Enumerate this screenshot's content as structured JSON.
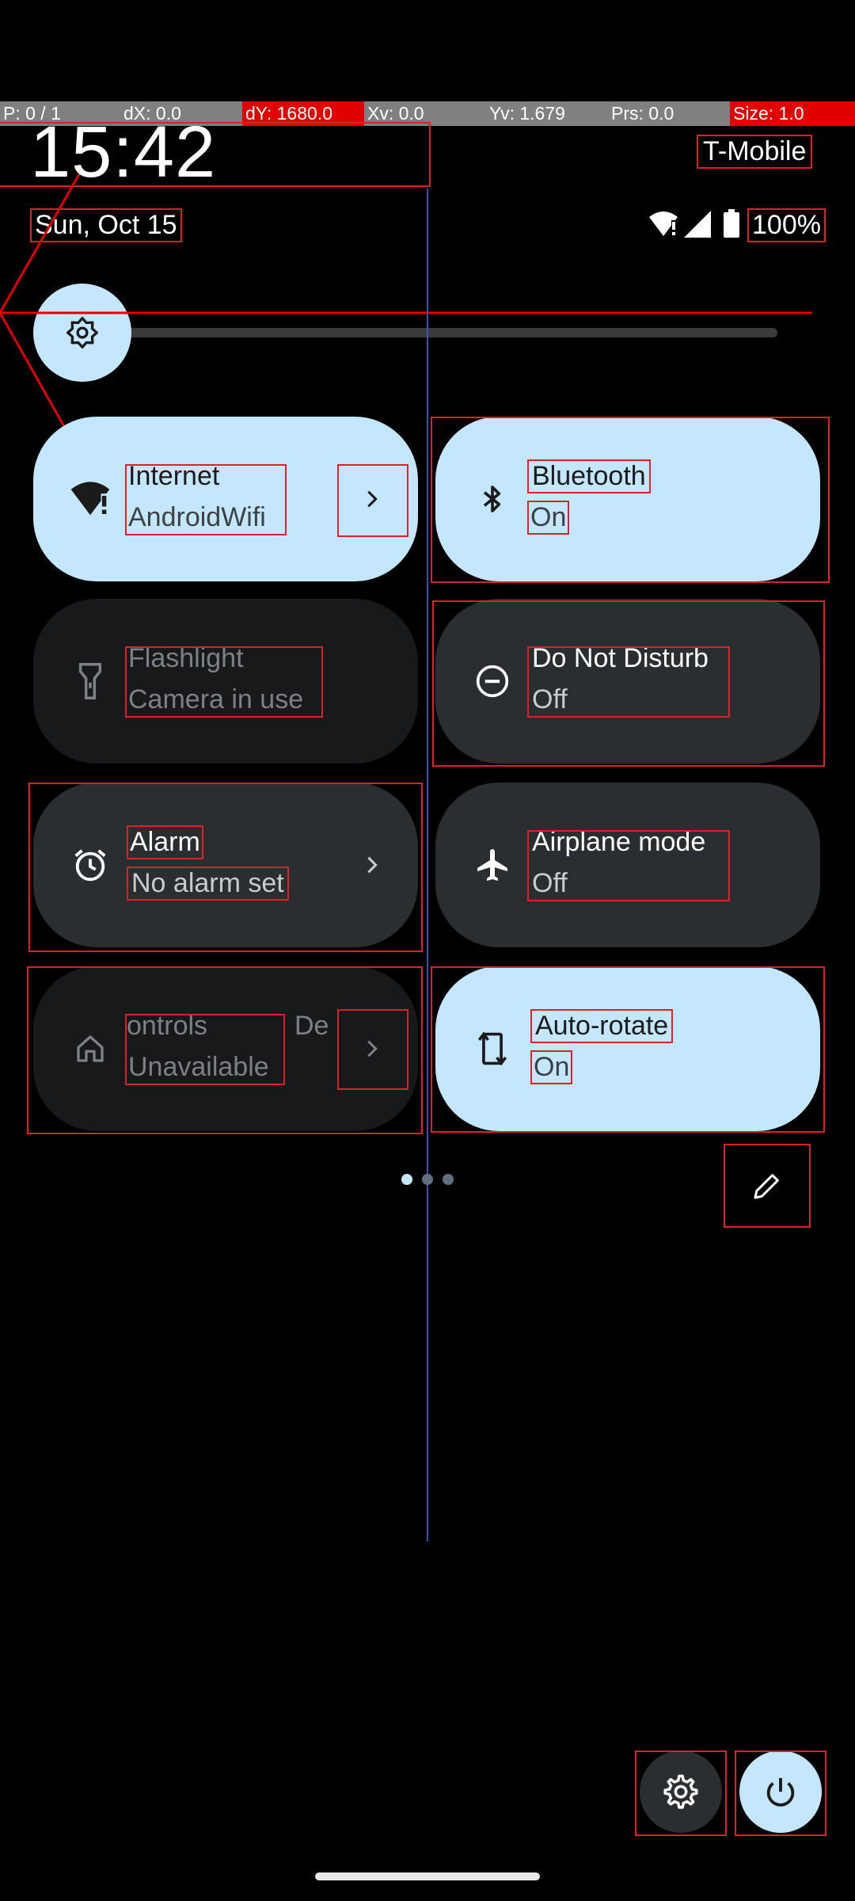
{
  "pointer_location": {
    "p": "P: 0 / 1",
    "dx": "dX: 0.0",
    "dy": "dY: 1680.0",
    "xv": "Xv: 0.0",
    "yv": "Yv: 1.679",
    "prs": "Prs: 0.0",
    "size": "Size: 1.0"
  },
  "status": {
    "time": "15:42",
    "carrier": "T-Mobile",
    "date": "Sun, Oct 15",
    "battery": "100%"
  },
  "brightness": {
    "level": 0.04
  },
  "tiles": [
    {
      "label": "Internet",
      "sub": "AndroidWifi",
      "state": "on",
      "icon": "wifi-alert-icon",
      "chevron": true
    },
    {
      "label": "Bluetooth",
      "sub": "On",
      "state": "on",
      "icon": "bluetooth-icon",
      "chevron": false
    },
    {
      "label": "Flashlight",
      "sub": "Camera in use",
      "state": "unavailable",
      "icon": "flashlight-icon",
      "chevron": false
    },
    {
      "label": "Do Not Disturb",
      "sub": "Off",
      "state": "off",
      "icon": "do-not-disturb-icon",
      "chevron": false
    },
    {
      "label": "Alarm",
      "sub": "No alarm set",
      "state": "off",
      "icon": "alarm-icon",
      "chevron": true
    },
    {
      "label": "Airplane mode",
      "sub": "Off",
      "state": "off",
      "icon": "airplane-icon",
      "chevron": false
    },
    {
      "label": "ontrols",
      "label_extra": "De",
      "sub": "Unavailable",
      "state": "unavailable",
      "icon": "home-icon",
      "chevron": true
    },
    {
      "label": "Auto-rotate",
      "sub": "On",
      "state": "on",
      "icon": "auto-rotate-icon",
      "chevron": false
    }
  ],
  "pages": {
    "count": 3,
    "current": 2
  },
  "colors": {
    "tile_on": "#c4e7ff",
    "tile_off": "#2b2e31",
    "overlay_red": "#d8232a"
  }
}
